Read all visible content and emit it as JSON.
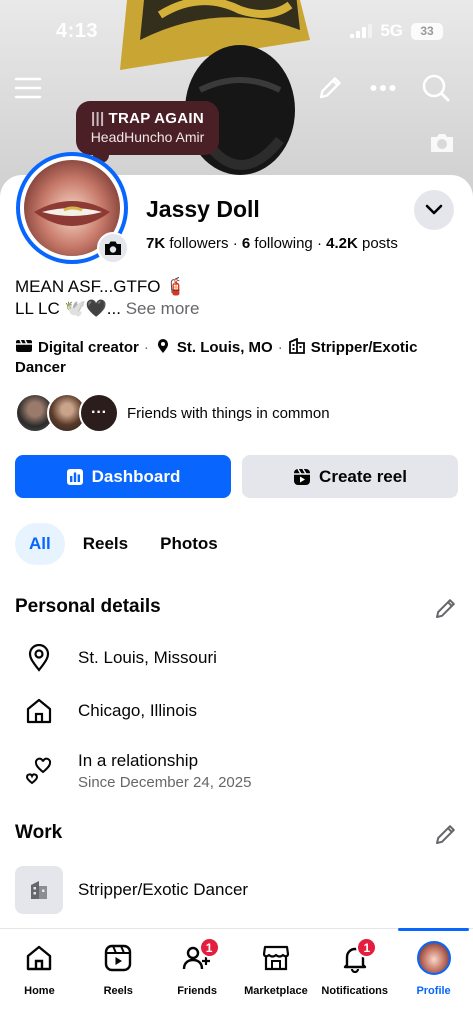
{
  "status": {
    "time": "4:13",
    "network": "5G",
    "battery": "33"
  },
  "music": {
    "title": "TRAP AGAIN",
    "artist": "HeadHuncho Amir"
  },
  "profile": {
    "name": "Jassy Doll",
    "followers_count": "7K",
    "followers_label": "followers",
    "following_count": "6",
    "following_label": "following",
    "posts_count": "4.2K",
    "posts_label": "posts",
    "bio_line1": "MEAN ASF...GTFO 🧯",
    "bio_line2": "LL LC 🕊️🖤...",
    "see_more": "See more",
    "category": "Digital creator",
    "location": "St. Louis, MO",
    "job": "Stripper/Exotic Dancer",
    "friends_text": "Friends with things in common",
    "friends_more": "···"
  },
  "actions": {
    "dashboard": "Dashboard",
    "create_reel": "Create reel"
  },
  "tabs": [
    {
      "label": "All",
      "active": true
    },
    {
      "label": "Reels",
      "active": false
    },
    {
      "label": "Photos",
      "active": false
    }
  ],
  "personal": {
    "title": "Personal details",
    "current_city": "St. Louis, Missouri",
    "hometown": "Chicago, Illinois",
    "relationship": "In a relationship",
    "relationship_since": "Since December 24, 2025"
  },
  "work": {
    "title": "Work",
    "job": "Stripper/Exotic Dancer"
  },
  "nav": [
    {
      "label": "Home",
      "icon": "home-icon",
      "badge": ""
    },
    {
      "label": "Reels",
      "icon": "reels-icon",
      "badge": ""
    },
    {
      "label": "Friends",
      "icon": "friends-icon",
      "badge": "1"
    },
    {
      "label": "Marketplace",
      "icon": "marketplace-icon",
      "badge": ""
    },
    {
      "label": "Notifications",
      "icon": "bell-icon",
      "badge": "1"
    },
    {
      "label": "Profile",
      "icon": "profile-avatar",
      "badge": ""
    }
  ],
  "colors": {
    "accent": "#0866ff",
    "badge": "#e41e3f",
    "music_pill": "#4b1f26"
  }
}
